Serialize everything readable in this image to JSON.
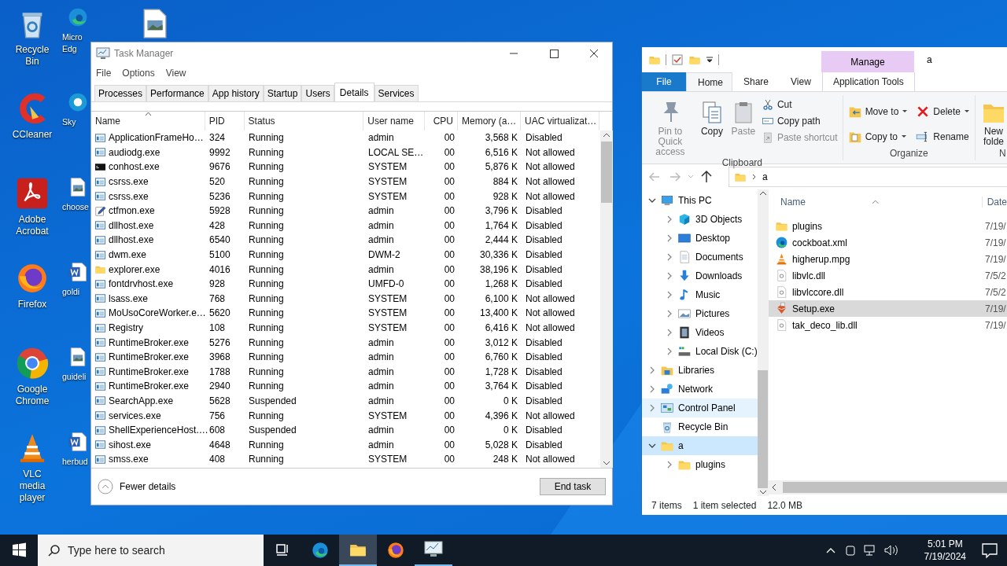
{
  "desktop": {
    "icons": [
      {
        "label": "Recycle Bin",
        "kind": "recycle"
      },
      {
        "label": "CCleaner",
        "kind": "ccleaner"
      },
      {
        "label": "Adobe Acrobat",
        "kind": "acrobat"
      },
      {
        "label": "Firefox",
        "kind": "firefox"
      },
      {
        "label": "Google Chrome",
        "kind": "chrome"
      },
      {
        "label": "VLC media player",
        "kind": "vlc"
      },
      {
        "label": "Micro Edg",
        "kind": "edge"
      },
      {
        "label": "Sky",
        "kind": "skype"
      },
      {
        "label": "choose",
        "kind": "image"
      },
      {
        "label": "goldi",
        "kind": "word"
      },
      {
        "label": "guideli",
        "kind": "image"
      },
      {
        "label": "herbud",
        "kind": "word"
      },
      {
        "kind": "image"
      }
    ]
  },
  "task_manager": {
    "title": "Task Manager",
    "menu": [
      "File",
      "Options",
      "View"
    ],
    "tabs": [
      {
        "label": "Processes",
        "selected": false
      },
      {
        "label": "Performance",
        "selected": false
      },
      {
        "label": "App history",
        "selected": false
      },
      {
        "label": "Startup",
        "selected": false
      },
      {
        "label": "Users",
        "selected": false
      },
      {
        "label": "Details",
        "selected": true
      },
      {
        "label": "Services",
        "selected": false
      }
    ],
    "columns": [
      "Name",
      "PID",
      "Status",
      "User name",
      "CPU",
      "Memory (a…",
      "UAC virtualizat…"
    ],
    "rows": [
      {
        "kind": "app",
        "name": "ApplicationFrameHo…",
        "pid": "324",
        "status": "Running",
        "user": "admin",
        "cpu": "00",
        "memory": "3,568 K",
        "uac": "Disabled"
      },
      {
        "kind": "app",
        "name": "audiodg.exe",
        "pid": "9992",
        "status": "Running",
        "user": "LOCAL SE…",
        "cpu": "00",
        "memory": "6,516 K",
        "uac": "Not allowed"
      },
      {
        "kind": "console",
        "name": "conhost.exe",
        "pid": "9676",
        "status": "Running",
        "user": "SYSTEM",
        "cpu": "00",
        "memory": "5,876 K",
        "uac": "Not allowed"
      },
      {
        "kind": "app",
        "name": "csrss.exe",
        "pid": "520",
        "status": "Running",
        "user": "SYSTEM",
        "cpu": "00",
        "memory": "884 K",
        "uac": "Not allowed"
      },
      {
        "kind": "app",
        "name": "csrss.exe",
        "pid": "5236",
        "status": "Running",
        "user": "SYSTEM",
        "cpu": "00",
        "memory": "928 K",
        "uac": "Not allowed"
      },
      {
        "kind": "pen",
        "name": "ctfmon.exe",
        "pid": "5928",
        "status": "Running",
        "user": "admin",
        "cpu": "00",
        "memory": "3,796 K",
        "uac": "Disabled"
      },
      {
        "kind": "app",
        "name": "dllhost.exe",
        "pid": "428",
        "status": "Running",
        "user": "admin",
        "cpu": "00",
        "memory": "1,764 K",
        "uac": "Disabled"
      },
      {
        "kind": "app",
        "name": "dllhost.exe",
        "pid": "6540",
        "status": "Running",
        "user": "admin",
        "cpu": "00",
        "memory": "2,444 K",
        "uac": "Disabled"
      },
      {
        "kind": "app",
        "name": "dwm.exe",
        "pid": "5100",
        "status": "Running",
        "user": "DWM-2",
        "cpu": "00",
        "memory": "30,336 K",
        "uac": "Disabled"
      },
      {
        "kind": "folder",
        "name": "explorer.exe",
        "pid": "4016",
        "status": "Running",
        "user": "admin",
        "cpu": "00",
        "memory": "38,196 K",
        "uac": "Disabled"
      },
      {
        "kind": "app",
        "name": "fontdrvhost.exe",
        "pid": "928",
        "status": "Running",
        "user": "UMFD-0",
        "cpu": "00",
        "memory": "1,268 K",
        "uac": "Disabled"
      },
      {
        "kind": "app",
        "name": "lsass.exe",
        "pid": "768",
        "status": "Running",
        "user": "SYSTEM",
        "cpu": "00",
        "memory": "6,100 K",
        "uac": "Not allowed"
      },
      {
        "kind": "app",
        "name": "MoUsoCoreWorker.e…",
        "pid": "5620",
        "status": "Running",
        "user": "SYSTEM",
        "cpu": "00",
        "memory": "13,400 K",
        "uac": "Not allowed"
      },
      {
        "kind": "app",
        "name": "Registry",
        "pid": "108",
        "status": "Running",
        "user": "SYSTEM",
        "cpu": "00",
        "memory": "6,416 K",
        "uac": "Not allowed"
      },
      {
        "kind": "app",
        "name": "RuntimeBroker.exe",
        "pid": "5276",
        "status": "Running",
        "user": "admin",
        "cpu": "00",
        "memory": "3,012 K",
        "uac": "Disabled"
      },
      {
        "kind": "app",
        "name": "RuntimeBroker.exe",
        "pid": "3968",
        "status": "Running",
        "user": "admin",
        "cpu": "00",
        "memory": "6,760 K",
        "uac": "Disabled"
      },
      {
        "kind": "app",
        "name": "RuntimeBroker.exe",
        "pid": "1788",
        "status": "Running",
        "user": "admin",
        "cpu": "00",
        "memory": "1,728 K",
        "uac": "Disabled"
      },
      {
        "kind": "app",
        "name": "RuntimeBroker.exe",
        "pid": "2940",
        "status": "Running",
        "user": "admin",
        "cpu": "00",
        "memory": "3,764 K",
        "uac": "Disabled"
      },
      {
        "kind": "app",
        "name": "SearchApp.exe",
        "pid": "5628",
        "status": "Suspended",
        "user": "admin",
        "cpu": "00",
        "memory": "0 K",
        "uac": "Disabled"
      },
      {
        "kind": "app",
        "name": "services.exe",
        "pid": "756",
        "status": "Running",
        "user": "SYSTEM",
        "cpu": "00",
        "memory": "4,396 K",
        "uac": "Not allowed"
      },
      {
        "kind": "app",
        "name": "ShellExperienceHost.…",
        "pid": "608",
        "status": "Suspended",
        "user": "admin",
        "cpu": "00",
        "memory": "0 K",
        "uac": "Disabled"
      },
      {
        "kind": "app",
        "name": "sihost.exe",
        "pid": "4648",
        "status": "Running",
        "user": "admin",
        "cpu": "00",
        "memory": "5,028 K",
        "uac": "Disabled"
      },
      {
        "kind": "app",
        "name": "smss.exe",
        "pid": "408",
        "status": "Running",
        "user": "SYSTEM",
        "cpu": "00",
        "memory": "248 K",
        "uac": "Not allowed"
      }
    ],
    "fewer_details": "Fewer details",
    "end_task": "End task"
  },
  "explorer": {
    "title": "a",
    "context_tab": "Manage",
    "ribbon_tabs": [
      {
        "label": "File",
        "kind": "file",
        "selected": false
      },
      {
        "label": "Home",
        "kind": "tab",
        "selected": true
      },
      {
        "label": "Share",
        "kind": "tab",
        "selected": false
      },
      {
        "label": "View",
        "kind": "tab",
        "selected": false
      },
      {
        "label": "Application Tools",
        "kind": "context",
        "selected": false
      }
    ],
    "clipboard": {
      "large": [
        {
          "label": "Pin to Quick access",
          "kind": "pin",
          "disabled": true
        },
        {
          "label": "Copy",
          "kind": "copy",
          "disabled": false
        },
        {
          "label": "Paste",
          "kind": "paste",
          "disabled": true
        }
      ],
      "small": [
        {
          "label": "Cut",
          "kind": "cut",
          "disabled": false
        },
        {
          "label": "Copy path",
          "kind": "path",
          "disabled": false
        },
        {
          "label": "Paste shortcut",
          "kind": "shortcut",
          "disabled": true
        }
      ],
      "group": "Clipboard"
    },
    "organize": {
      "items": [
        {
          "label": "Move to",
          "kind": "move",
          "dropdown": true
        },
        {
          "label": "Delete",
          "kind": "delete",
          "dropdown": true
        },
        {
          "label": "Copy to",
          "kind": "copyto",
          "dropdown": true
        },
        {
          "label": "Rename",
          "kind": "rename",
          "dropdown": false
        }
      ],
      "group": "Organize"
    },
    "new": {
      "label": "New folde",
      "group": "N"
    },
    "address": "a",
    "nav": [
      {
        "label": "This PC",
        "kind": "pc",
        "expanded": true,
        "selected": false,
        "children": [
          {
            "label": "3D Objects",
            "kind": "cube",
            "expanded": false,
            "selected": false
          },
          {
            "label": "Desktop",
            "kind": "desktop",
            "expanded": false,
            "selected": false
          },
          {
            "label": "Documents",
            "kind": "documents",
            "expanded": false,
            "selected": false
          },
          {
            "label": "Downloads",
            "kind": "download",
            "expanded": false,
            "selected": false
          },
          {
            "label": "Music",
            "kind": "music",
            "expanded": false,
            "selected": false
          },
          {
            "label": "Pictures",
            "kind": "pictures",
            "expanded": false,
            "selected": false
          },
          {
            "label": "Videos",
            "kind": "videos",
            "expanded": false,
            "selected": false
          },
          {
            "label": "Local Disk (C:)",
            "kind": "disk",
            "expanded": false,
            "selected": false
          }
        ]
      },
      {
        "label": "Libraries",
        "kind": "libraries",
        "expanded": false,
        "selected": false
      },
      {
        "label": "Network",
        "kind": "network",
        "expanded": false,
        "selected": false
      },
      {
        "label": "Control Panel",
        "kind": "control",
        "expanded": false,
        "selected": false,
        "hovered": true
      },
      {
        "label": "Recycle Bin",
        "kind": "recycle",
        "selected": false
      },
      {
        "label": "a",
        "kind": "folder",
        "expanded": true,
        "selected": true,
        "children": [
          {
            "label": "plugins",
            "kind": "folder",
            "expanded": false,
            "selected": false
          }
        ]
      }
    ],
    "columns": [
      "Name",
      "Date"
    ],
    "files": [
      {
        "name": "plugins",
        "kind": "folder",
        "date": "7/19/",
        "selected": false
      },
      {
        "name": "cockboat.xml",
        "kind": "edge",
        "date": "7/19/",
        "selected": false
      },
      {
        "name": "higherup.mpg",
        "kind": "vlc",
        "date": "7/19/",
        "selected": false
      },
      {
        "name": "libvlc.dll",
        "kind": "dll",
        "date": "7/5/2",
        "selected": false
      },
      {
        "name": "libvlccore.dll",
        "kind": "dll",
        "date": "7/5/2",
        "selected": false
      },
      {
        "name": "Setup.exe",
        "kind": "setup",
        "date": "7/19/",
        "selected": true
      },
      {
        "name": "tak_deco_lib.dll",
        "kind": "dll",
        "date": "7/19/",
        "selected": false
      }
    ],
    "status": [
      "7 items",
      "1 item selected",
      "12.0 MB"
    ]
  },
  "taskbar": {
    "search_placeholder": "Type here to search",
    "apps": [
      {
        "kind": "taskview",
        "active": false,
        "open": false
      },
      {
        "kind": "edge",
        "active": false,
        "open": false
      },
      {
        "kind": "explorer",
        "active": true,
        "open": true
      },
      {
        "kind": "firefox",
        "active": false,
        "open": false
      },
      {
        "kind": "taskmgr",
        "active": false,
        "open": true
      }
    ],
    "time": "5:01 PM",
    "date": "7/19/2024"
  }
}
